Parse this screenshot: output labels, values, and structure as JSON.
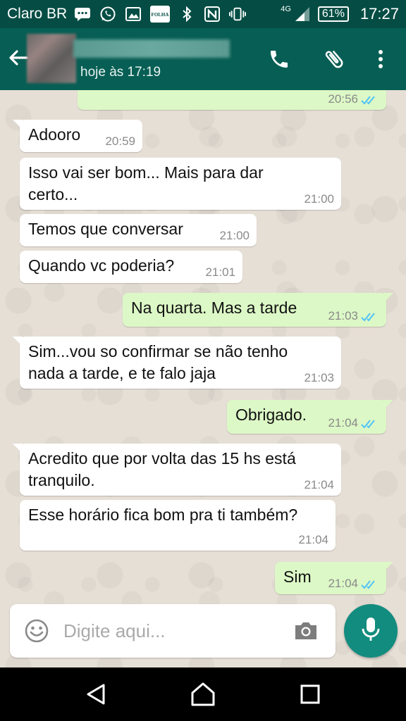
{
  "statusbar": {
    "carrier": "Claro BR",
    "network": "4G",
    "battery": "61%",
    "time": "17:27",
    "icons": [
      "message-icon",
      "whatsapp-icon",
      "image-icon",
      "news-app-icon",
      "bluetooth-icon",
      "nfc-icon",
      "vibrate-icon",
      "signal-icon"
    ],
    "app_icon_text": "FOLHA"
  },
  "header": {
    "last_seen": "hoje às 17:19",
    "bg_color": "#075e54"
  },
  "messages": [
    {
      "dir": "out",
      "text": "",
      "time": "20:56",
      "read": true
    },
    {
      "dir": "in",
      "text": "Adooro",
      "time": "20:59"
    },
    {
      "dir": "in",
      "text": "Isso vai ser bom... Mais para dar certo...",
      "time": "21:00"
    },
    {
      "dir": "in",
      "text": "Temos que conversar",
      "time": "21:00"
    },
    {
      "dir": "in",
      "text": "Quando vc poderia?",
      "time": "21:01"
    },
    {
      "dir": "out",
      "text": "Na quarta. Mas a tarde",
      "time": "21:03",
      "read": true
    },
    {
      "dir": "in",
      "text": "Sim...vou so confirmar se não tenho nada a tarde, e te falo jaja",
      "time": "21:03"
    },
    {
      "dir": "out",
      "text": "Obrigado.",
      "time": "21:04",
      "read": true
    },
    {
      "dir": "in",
      "text": "Acredito que por volta das 15 hs está tranquilo.",
      "time": "21:04"
    },
    {
      "dir": "in",
      "text": "Esse horário fica bom pra ti também?",
      "time": "21:04"
    },
    {
      "dir": "out",
      "text": "Sim",
      "time": "21:04",
      "read": true
    }
  ],
  "input": {
    "placeholder": "Digite aqui..."
  },
  "colors": {
    "incoming": "#ffffff",
    "outgoing": "#dcf8c6",
    "read_ticks": "#4fc3f7",
    "accent": "#128c7e"
  }
}
